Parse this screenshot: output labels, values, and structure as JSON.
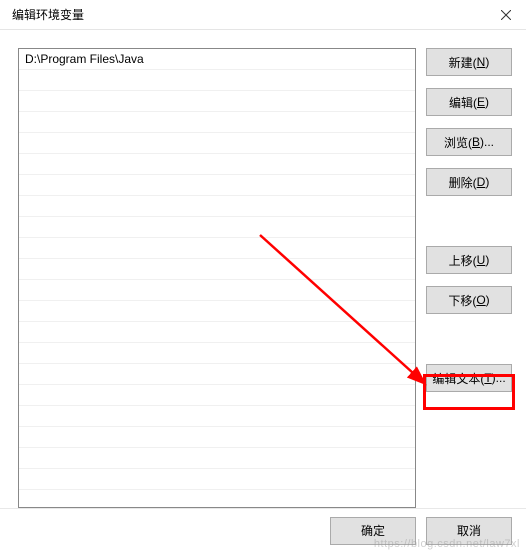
{
  "title": "编辑环境变量",
  "list": {
    "items": [
      "D:\\Program Files\\Java"
    ]
  },
  "buttons": {
    "new": "新建(",
    "new_key": "N",
    "new_suffix": ")",
    "edit": "编辑(",
    "edit_key": "E",
    "edit_suffix": ")",
    "browse": "浏览(",
    "browse_key": "B",
    "browse_suffix": ")...",
    "delete": "删除(",
    "delete_key": "D",
    "delete_suffix": ")",
    "moveup": "上移(",
    "moveup_key": "U",
    "moveup_suffix": ")",
    "movedown": "下移(",
    "movedown_key": "O",
    "movedown_suffix": ")",
    "edittext": "编辑文本(",
    "edittext_key": "T",
    "edittext_suffix": ")..."
  },
  "footer": {
    "ok": "确定",
    "cancel": "取消"
  },
  "watermark": "https://blog.csdn.net/law7xl"
}
